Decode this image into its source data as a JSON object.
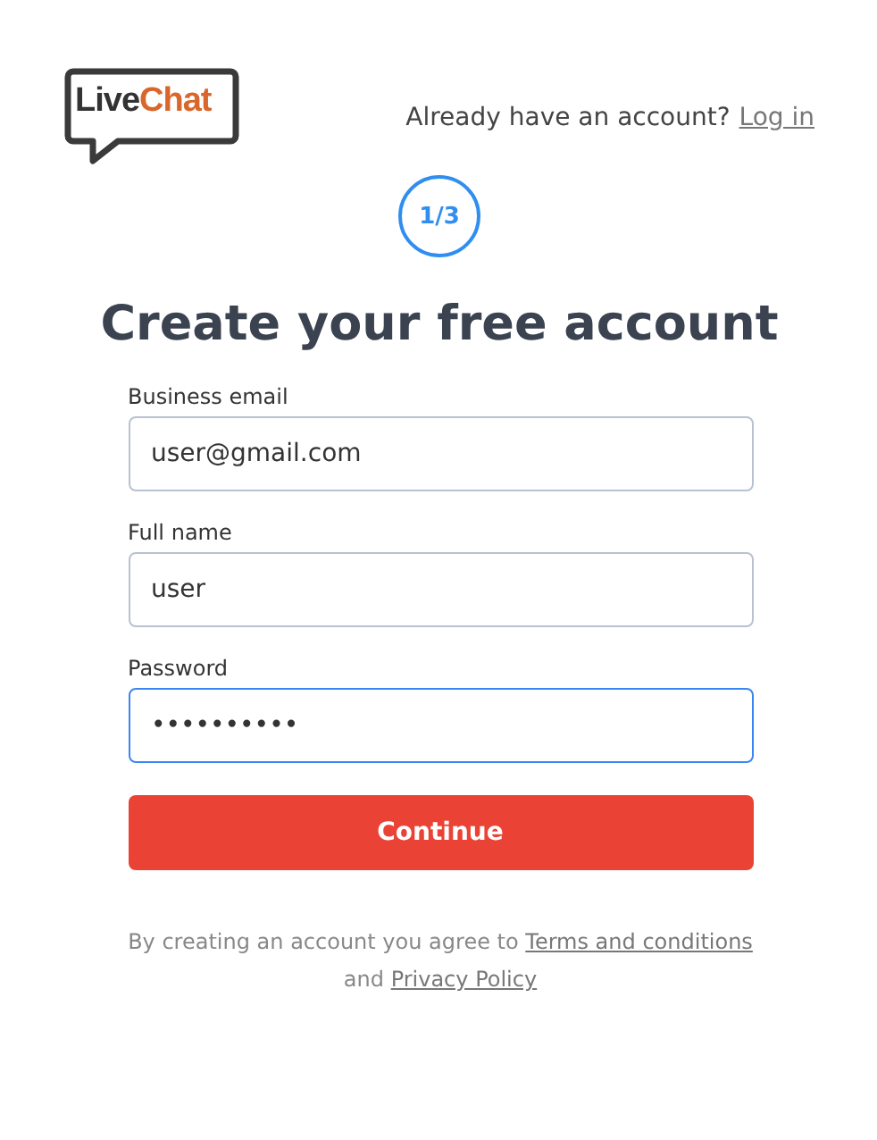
{
  "logo": {
    "parts": [
      "Live",
      "Chat"
    ]
  },
  "header": {
    "prompt": "Already have an account?",
    "link": "Log in"
  },
  "step": "1/3",
  "title": "Create your free account",
  "fields": [
    {
      "label": "Business email",
      "value": "user@gmail.com",
      "focused": false
    },
    {
      "label": "Full name",
      "value": "user",
      "focused": false
    },
    {
      "label": "Password",
      "value": "••••••••••",
      "focused": true
    }
  ],
  "submit": "Continue",
  "legal": {
    "text": "By creating an account you agree to",
    "terms": "Terms and conditions",
    "joiner": "and",
    "privacy": "Privacy Policy"
  }
}
